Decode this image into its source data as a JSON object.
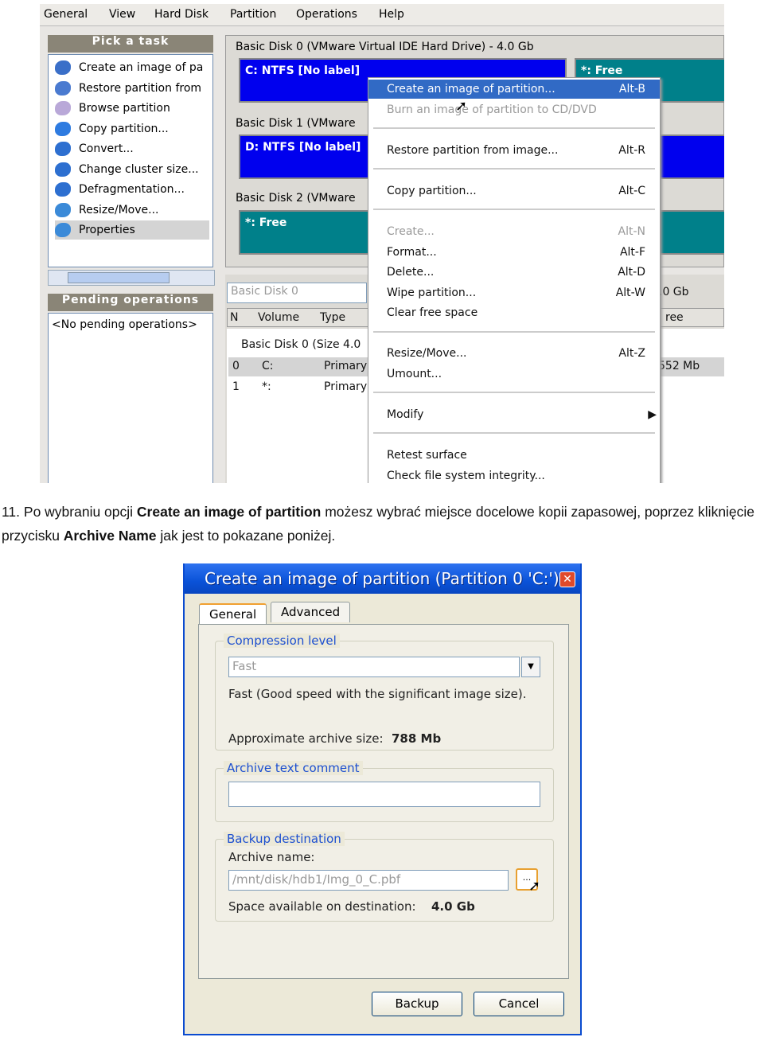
{
  "screenshot1": {
    "menu": [
      "General",
      "View",
      "Hard Disk",
      "Partition",
      "Operations",
      "Help"
    ],
    "pick_task": {
      "header": "Pick a task",
      "items": [
        "Create an image of pa",
        "Restore partition from",
        "Browse partition",
        "Copy partition...",
        "Convert...",
        "Change cluster size...",
        "Defragmentation...",
        "Resize/Move...",
        "Properties"
      ]
    },
    "pending": {
      "header": "Pending operations",
      "text": "<No pending operations>"
    },
    "disks": [
      {
        "label": "Basic Disk 0 (VMware Virtual IDE Hard Drive) - 4.0 Gb",
        "partition": "C: NTFS [No label]",
        "free": "*: Free"
      },
      {
        "label": "Basic Disk 1 (VMware",
        "partition": "D: NTFS [No label]"
      },
      {
        "label": "Basic Disk 2 (VMware",
        "partition": "*: Free"
      }
    ],
    "disk_select": "Basic Disk 0",
    "disk_size_tail": ".0 Gb",
    "columns": [
      "N",
      "Volume",
      "Type"
    ],
    "col_tail": "ree",
    "group_row": "Basic Disk 0 (Size 4.0",
    "rows": [
      [
        "0",
        "C:",
        "Primary",
        "552 Mb"
      ],
      [
        "1",
        "*:",
        "Primary",
        ""
      ]
    ],
    "context_menu": [
      {
        "label": "Create an image of partition...",
        "key": "Alt-B",
        "state": "highlighted"
      },
      {
        "label": "Burn an image of partition to CD/DVD",
        "key": "",
        "state": "disabled"
      },
      {
        "label": "Restore partition from image...",
        "key": "Alt-R",
        "state": "normal"
      },
      {
        "label": "Copy partition...",
        "key": "Alt-C",
        "state": "normal"
      },
      {
        "label": "Create...",
        "key": "Alt-N",
        "state": "disabled"
      },
      {
        "label": "Format...",
        "key": "Alt-F",
        "state": "normal"
      },
      {
        "label": "Delete...",
        "key": "Alt-D",
        "state": "normal"
      },
      {
        "label": "Wipe partition...",
        "key": "Alt-W",
        "state": "normal"
      },
      {
        "label": "Clear free space",
        "key": "",
        "state": "normal"
      },
      {
        "label": "Resize/Move...",
        "key": "Alt-Z",
        "state": "normal"
      },
      {
        "label": "Umount...",
        "key": "",
        "state": "normal"
      },
      {
        "label": "Modify",
        "key": "",
        "state": "submenu"
      },
      {
        "label": "Retest surface",
        "key": "",
        "state": "normal"
      },
      {
        "label": "Check file system integrity...",
        "key": "",
        "state": "normal"
      }
    ]
  },
  "paragraph": {
    "p1": "11. Po wybraniu opcji ",
    "b1": "Create an image of partition",
    "p2": " możesz wybrać miejsce docelowe kopii zapasowej, poprzez kliknięcie przycisku ",
    "b2": "Archive Name",
    "p3": " jak jest to pokazane poniżej."
  },
  "dialog": {
    "title": "Create an image of partition (Partition 0 'C:')",
    "tabs": [
      "General",
      "Advanced"
    ],
    "compression": {
      "legend": "Compression level",
      "value": "Fast",
      "description": "Fast (Good speed with the significant image size).",
      "size_label": "Approximate archive size:",
      "size_value": "788 Mb"
    },
    "comment": {
      "legend": "Archive text comment",
      "value": ""
    },
    "destination": {
      "legend": "Backup destination",
      "name_label": "Archive name:",
      "path": "/mnt/disk/hdb1/Img_0_C.pbf",
      "browse": "...",
      "space_label": "Space available on destination:",
      "space_value": "4.0 Gb"
    },
    "buttons": {
      "backup": "Backup",
      "cancel": "Cancel"
    }
  },
  "colors": {
    "partition_ntfs": "#0000ee",
    "partition_free": "#00808a",
    "menu_highlight": "#316ac5",
    "dialog_title": "#0a52d8"
  }
}
